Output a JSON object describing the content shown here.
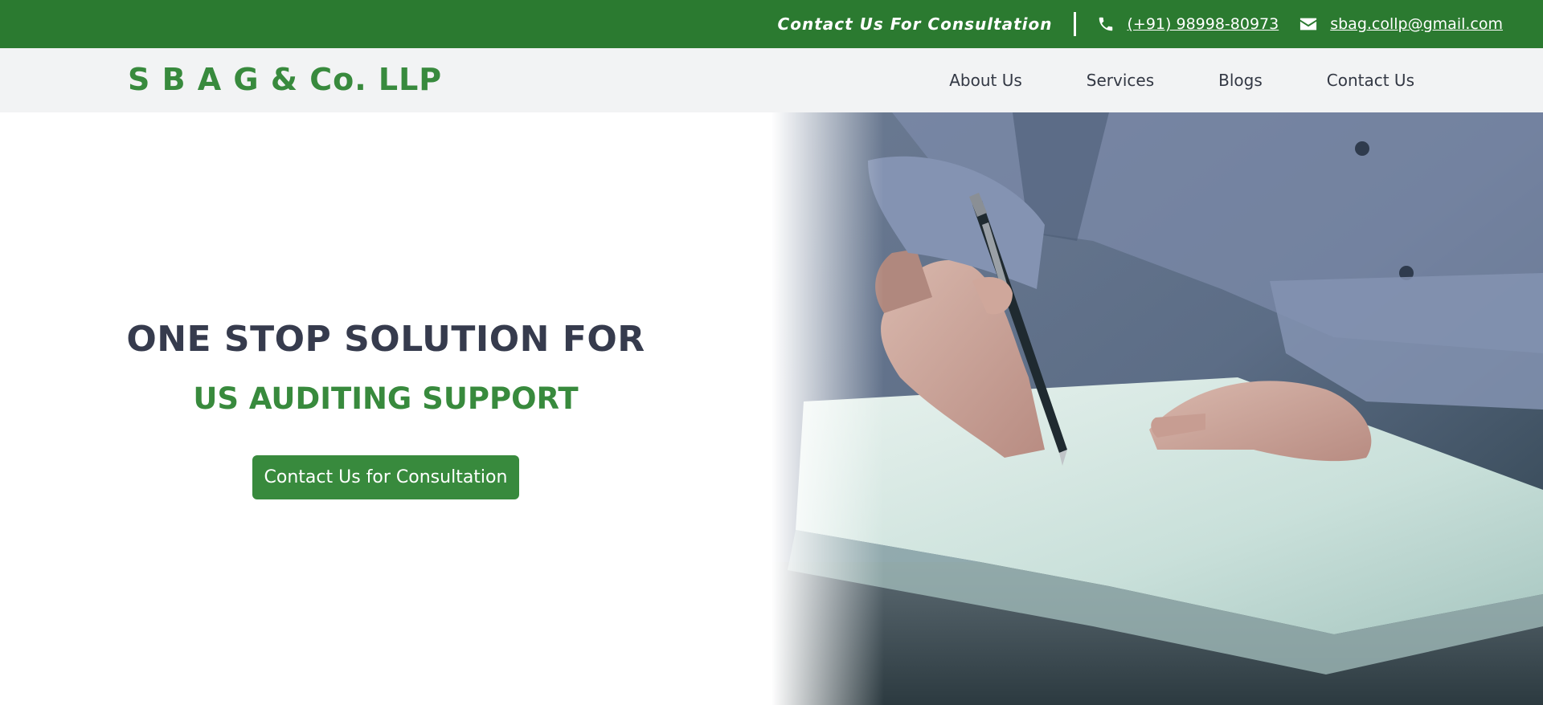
{
  "topbar": {
    "tagline": "Contact Us For Consultation",
    "phone": "(+91) 98998-80973",
    "email": "sbag.collp@gmail.com",
    "phone_icon": "phone-icon",
    "email_icon": "envelope-icon"
  },
  "navbar": {
    "brand": "S B A G & Co. LLP",
    "links": [
      "About Us",
      "Services",
      "Blogs",
      "Contact Us"
    ]
  },
  "hero": {
    "title": "ONE STOP SOLUTION FOR",
    "subtitle": "US AUDITING SUPPORT",
    "cta_label": "Contact Us for Consultation"
  },
  "colors": {
    "brand_green": "#388a3d",
    "topbar_green": "#2b7a30",
    "nav_bg": "#f2f3f4",
    "title_text": "#363b4d"
  }
}
